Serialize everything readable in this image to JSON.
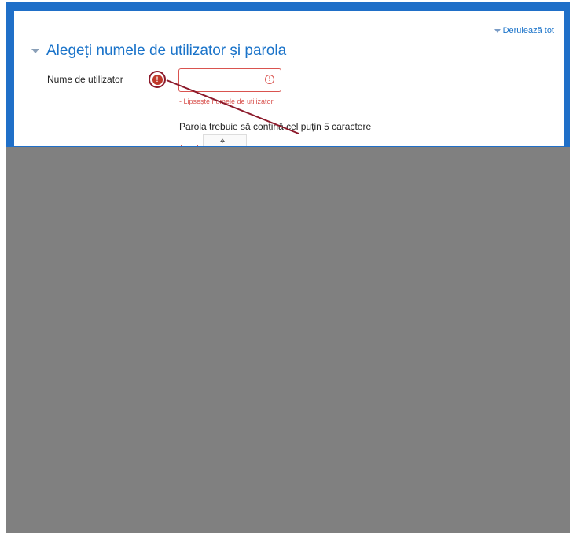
{
  "header": {
    "expand_all": "Derulează tot"
  },
  "section": {
    "title": "Alegeți numele de utilizator și parola"
  },
  "username": {
    "label": "Nume de utilizator",
    "value": "",
    "error": "- Lipsește numele de utilizator"
  },
  "password": {
    "rule": "Parola trebuie să conțină cel puțin 5 caractere"
  },
  "icons": {
    "error": "exclamation-circle-icon",
    "input_warning": "warning-circle-icon",
    "cursor": "mouse-cursor-icon",
    "collapse": "triangle-down-icon"
  },
  "colors": {
    "accent": "#1a73c9",
    "error": "#d9534f",
    "frame": "#1f6fc8",
    "overlay": "#808080"
  }
}
